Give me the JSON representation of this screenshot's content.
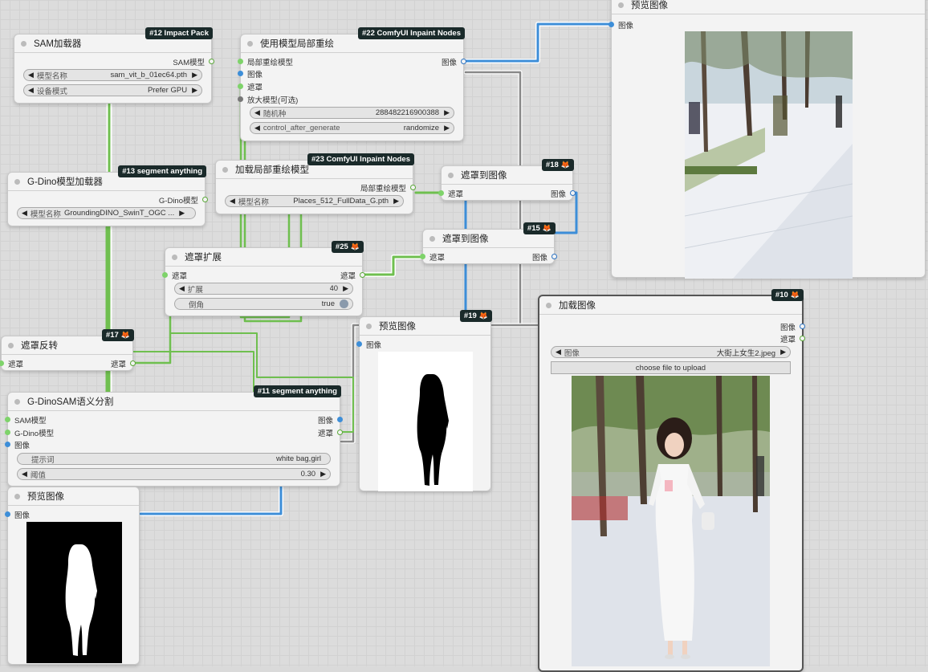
{
  "nodes": {
    "sam_loader": {
      "title": "SAM加载器",
      "badge": "#12 Impact Pack",
      "out": "SAM模型",
      "w_model": {
        "label": "模型名称",
        "value": "sam_vit_b_01ec64.pth"
      },
      "w_device": {
        "label": "设备模式",
        "value": "Prefer GPU"
      }
    },
    "inpaint_use": {
      "title": "使用模型局部重绘",
      "badge": "#22 ComfyUI Inpaint Nodes",
      "in1": "局部重绘模型",
      "in2": "图像",
      "in3": "遮罩",
      "in4": "放大模型(可选)",
      "out": "图像",
      "w_seed": {
        "label": "随机种",
        "value": "288482216900388"
      },
      "w_after": {
        "label": "control_after_generate",
        "value": "randomize"
      }
    },
    "gdino_loader": {
      "title": "G-Dino模型加载器",
      "badge": "#13 segment anything",
      "out": "G-Dino模型",
      "w_model": {
        "label": "模型名称",
        "value": "GroundingDINO_SwinT_OGC ..."
      }
    },
    "inpaint_load": {
      "title": "加载局部重绘模型",
      "badge": "#23 ComfyUI Inpaint Nodes",
      "out": "局部重绘模型",
      "w_model": {
        "label": "模型名称",
        "value": "Places_512_FullData_G.pth"
      }
    },
    "mask2img_a": {
      "title": "遮罩到图像",
      "badge": "#18",
      "in": "遮罩",
      "out": "图像"
    },
    "mask2img_b": {
      "title": "遮罩到图像",
      "badge": "#15",
      "in": "遮罩",
      "out": "图像"
    },
    "grow_mask": {
      "title": "遮罩扩展",
      "badge": "#25",
      "in": "遮罩",
      "out": "遮罩",
      "w_expand": {
        "label": "扩展",
        "value": "40"
      },
      "w_taper": {
        "label": "倒角",
        "value": "true"
      }
    },
    "invert": {
      "title": "遮罩反转",
      "badge": "#17",
      "in": "遮罩",
      "out": "遮罩"
    },
    "preview_mid": {
      "title": "预览图像",
      "badge": "#19",
      "in": "图像"
    },
    "preview_top": {
      "title": "预览图像",
      "in": "图像"
    },
    "load_image": {
      "title": "加载图像",
      "badge": "#10",
      "out1": "图像",
      "out2": "遮罩",
      "w_image": {
        "label": "图像",
        "value": "大街上女生2.jpeg"
      },
      "upload": "choose file to upload"
    },
    "gdinosam": {
      "title": "G-DinoSAM语义分割",
      "badge": "#11 segment anything",
      "in1": "SAM模型",
      "in2": "G-Dino模型",
      "in3": "图像",
      "out1": "图像",
      "out2": "遮罩",
      "w_prompt": {
        "label": "提示词",
        "value": "white bag,girl"
      },
      "w_thresh": {
        "label": "阈值",
        "value": "0.30"
      }
    },
    "preview_bl": {
      "title": "预览图像",
      "in": "图像"
    }
  },
  "icons": {
    "arrow_left": "◀",
    "arrow_right": "▶",
    "fox": "🦊"
  },
  "colors": {
    "wire_green": "#6fbf4f",
    "wire_blue": "#3d8ed8",
    "wire_gray": "#888888",
    "badge_bg": "#1a2a2a"
  }
}
